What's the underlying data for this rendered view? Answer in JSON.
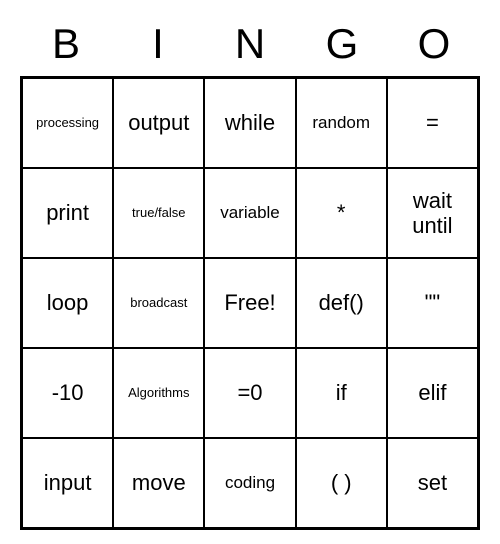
{
  "header": [
    "B",
    "I",
    "N",
    "G",
    "O"
  ],
  "cells": [
    [
      {
        "text": "processing",
        "size": "small"
      },
      {
        "text": "output",
        "size": ""
      },
      {
        "text": "while",
        "size": ""
      },
      {
        "text": "random",
        "size": "med"
      },
      {
        "text": "=",
        "size": ""
      }
    ],
    [
      {
        "text": "print",
        "size": ""
      },
      {
        "text": "true/false",
        "size": "small"
      },
      {
        "text": "variable",
        "size": "med"
      },
      {
        "text": "*",
        "size": ""
      },
      {
        "text": "wait until",
        "size": ""
      }
    ],
    [
      {
        "text": "loop",
        "size": ""
      },
      {
        "text": "broadcast",
        "size": "small"
      },
      {
        "text": "Free!",
        "size": ""
      },
      {
        "text": "def()",
        "size": ""
      },
      {
        "text": "\"\"",
        "size": ""
      }
    ],
    [
      {
        "text": "-10",
        "size": ""
      },
      {
        "text": "Algorithms",
        "size": "small"
      },
      {
        "text": "=0",
        "size": ""
      },
      {
        "text": "if",
        "size": ""
      },
      {
        "text": "elif",
        "size": ""
      }
    ],
    [
      {
        "text": "input",
        "size": ""
      },
      {
        "text": "move",
        "size": ""
      },
      {
        "text": "coding",
        "size": "med"
      },
      {
        "text": "( )",
        "size": ""
      },
      {
        "text": "set",
        "size": ""
      }
    ]
  ]
}
